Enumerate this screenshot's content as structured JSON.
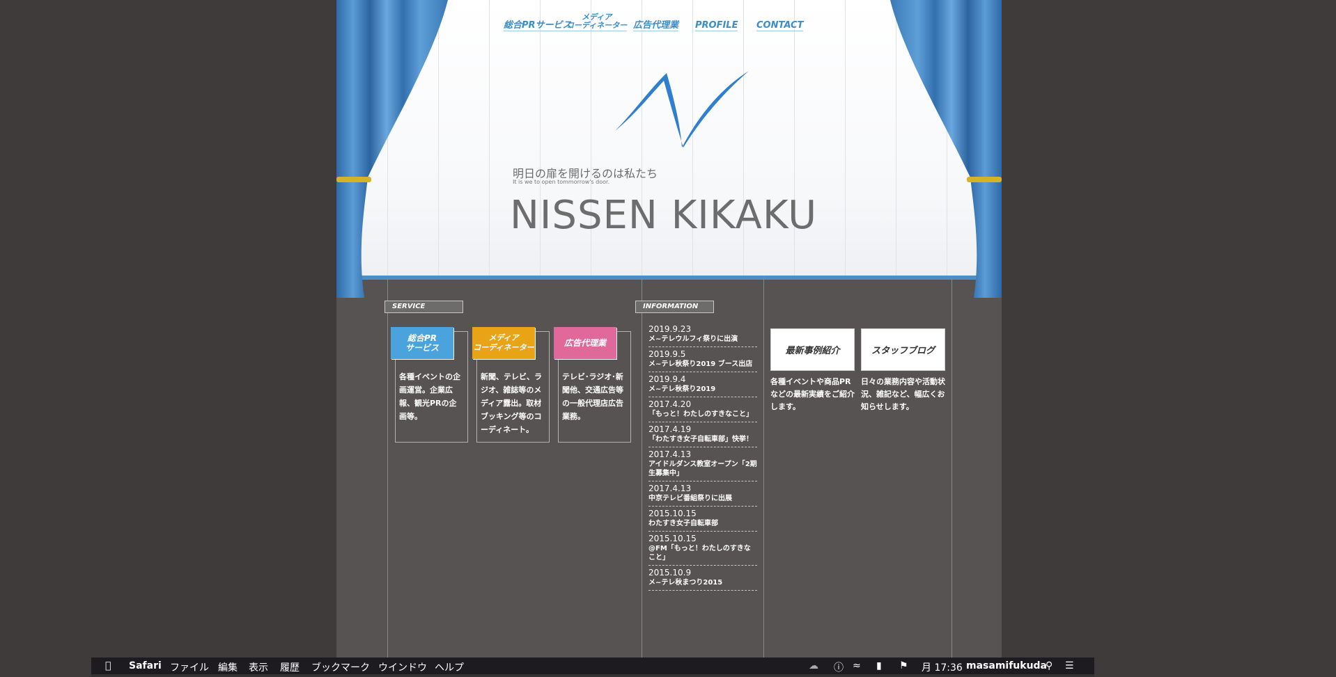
{
  "nav": [
    "総合PRサービス",
    "メディア\nコーディネーター",
    "広告代理業",
    "PROFILE",
    "CONTACT"
  ],
  "header": {
    "tagline": "明日の扉を開けるのは私たち",
    "tagline_en": "It is we to open tommorrow's door.",
    "brand": "NISSEN KIKAKU"
  },
  "service": {
    "label": "SERVICE",
    "items": [
      {
        "tag": "総合PR\nサービス",
        "color": "#4aa3dc",
        "desc": "各種イベントの企画運営。企業広報、観光PRの企画等。"
      },
      {
        "tag": "メディア\nコーディネーター",
        "color": "#e9a317",
        "desc": "新聞、テレビ、ラジオ、雑誌等のメディア露出。取材ブッキング等のコーディネート。"
      },
      {
        "tag": "広告代理業",
        "color": "#e0689b",
        "desc": "テレビ･ラジオ･新聞他、交通広告等の一般代理店広告業務。"
      }
    ]
  },
  "information": {
    "label": "INFORMATION",
    "items": [
      {
        "date": "2019.9.23",
        "title": "メ~テレウルフィ祭りに出演"
      },
      {
        "date": "2019.9.5",
        "title": "メ~テレ秋祭り2019 ブース出店"
      },
      {
        "date": "2019.9.4",
        "title": "メ~テレ秋祭り2019"
      },
      {
        "date": "2017.4.20",
        "title": "「もっと！わたしのすきなこと」"
      },
      {
        "date": "2017.4.19",
        "title": "「わたすき女子自転車部」快挙！"
      },
      {
        "date": "2017.4.13",
        "title": "アイドルダンス教室オープン「2期生募集中」"
      },
      {
        "date": "2017.4.13",
        "title": "中京テレビ番組祭りに出展"
      },
      {
        "date": "2015.10.15",
        "title": "わたすき女子自転車部"
      },
      {
        "date": "2015.10.15",
        "title": "@FM「もっと！わたしのすきなこと」"
      },
      {
        "date": "2015.10.9",
        "title": "メ~テレ秋まつり2015"
      }
    ]
  },
  "right": {
    "cases_button": "最新事例紹介",
    "cases_desc": "各種イベントや商品PRなどの最新実績をご紹介します。",
    "blog_button": "スタッフブログ",
    "blog_desc": "日々の業務内容や活動状況、雑記など、幅広くお知らせします。"
  },
  "menubar": {
    "app": "Safari",
    "menus": [
      "ファイル",
      "編集",
      "表示",
      "履歴",
      "ブックマーク",
      "ウインドウ",
      "ヘルプ"
    ],
    "clock": "月 17:36",
    "user": "masamifukuda"
  }
}
